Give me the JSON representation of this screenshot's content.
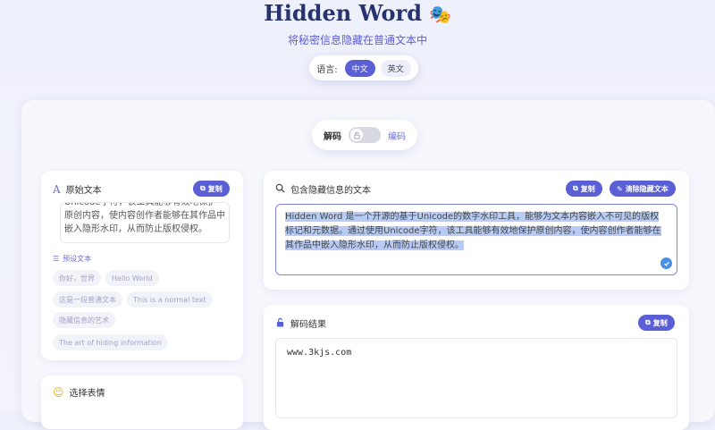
{
  "header": {
    "title": "Hidden Word",
    "subtitle": "将秘密信息隐藏在普通文本中",
    "logo_icon": "theater-masks-icon"
  },
  "language": {
    "label": "语言:",
    "options": [
      "中文",
      "英文"
    ],
    "selected": "中文"
  },
  "mode": {
    "decode_label": "解码",
    "encode_label": "编码",
    "active": "解码",
    "toggle_icon": "lock-icon"
  },
  "original": {
    "title": "原始文本",
    "copy_label": "复制",
    "text": "Unicode字符，该工具能够有效地保护原创内容，使内容创作者能够在其作品中嵌入隐形水印，从而防止版权侵权。",
    "presets_label": "预设文本",
    "presets": [
      "你好，世界",
      "Hello World",
      "这是一段普通文本",
      "This is a normal text",
      "隐藏信息的艺术",
      "The art of hiding information"
    ]
  },
  "emoji": {
    "title": "选择表情"
  },
  "hidden": {
    "title": "包含隐藏信息的文本",
    "copy_label": "复制",
    "clear_label": "清除隐藏文本",
    "text": "Hidden Word 是一个开源的基于Unicode的数字水印工具，能够为文本内容嵌入不可见的版权标记和元数据。通过使用Unicode字符，该工具能够有效地保护原创内容，使内容创作者能够在其作品中嵌入隐形水印，从而防止版权侵权。"
  },
  "result": {
    "title": "解码结果",
    "copy_label": "复制",
    "text": "www.3kjs.com"
  },
  "colors": {
    "accent": "#5b5fd6",
    "title": "#27336e",
    "selection": "#b8cbf4"
  }
}
